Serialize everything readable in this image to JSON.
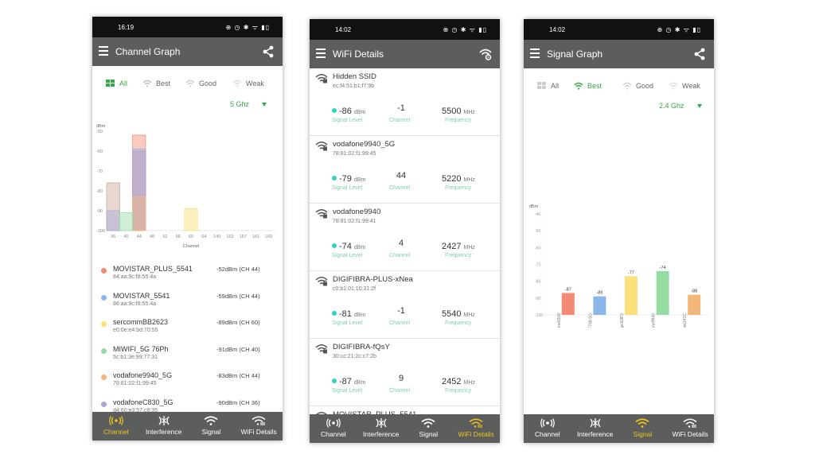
{
  "colors": {
    "app_bar": "#5c5e5e",
    "status_bar": "#111111",
    "accent_green": "#35a849",
    "active_nav": "#f2c417",
    "signal_dot": "#2fd3c0",
    "caption_teal": "#7fd0a9"
  },
  "nav": [
    "Channel",
    "Interference",
    "Signal",
    "WiFi Details"
  ],
  "phone1": {
    "time": "16:19",
    "title": "Channel Graph",
    "filters": [
      "All",
      "Best",
      "Good",
      "Weak"
    ],
    "active_filter": "All",
    "band": "5 Ghz",
    "active_nav": "Channel"
  },
  "phone2": {
    "time": "14:02",
    "title": "WiFi Details",
    "active_nav": "WiFi Details",
    "captions": {
      "level": "Signal Level",
      "channel": "Channel",
      "frequency": "Frequency",
      "dbm": "dBm",
      "mhz": "MHz"
    },
    "aps": [
      {
        "ssid": "Hidden SSID",
        "mac": "ec:f4:51:b1:f7:9b",
        "level": "-86",
        "channel": "-1",
        "frequency": "5500"
      },
      {
        "ssid": "vodafone9940_5G",
        "mac": "78:81:02:f1:99:45",
        "level": "-79",
        "channel": "44",
        "frequency": "5220"
      },
      {
        "ssid": "vodafone9940",
        "mac": "78:81:02:f1:99:41",
        "level": "-74",
        "channel": "4",
        "frequency": "2427"
      },
      {
        "ssid": "DIGIFIBRA-PLUS-xNea",
        "mac": "c0:b1:01:10:31:2f",
        "level": "-81",
        "channel": "-1",
        "frequency": "5540"
      },
      {
        "ssid": "DIGIFIBRA-fQsY",
        "mac": "30:cc:21:2c:c7:2b",
        "level": "-87",
        "channel": "9",
        "frequency": "2452"
      }
    ],
    "partial_ssid": "MOVISTAR_PLUS_5541"
  },
  "phone3": {
    "time": "14:02",
    "title": "Signal Graph",
    "filters": [
      "All",
      "Best",
      "Good",
      "Weak"
    ],
    "active_filter": "Best",
    "band": "2.4 Ghz",
    "active_nav": "Signal"
  },
  "chart_data": [
    {
      "type": "bar",
      "ylabel": "dBm",
      "xlabel": "Channel",
      "ylim": [
        -100,
        -50
      ],
      "yticks": [
        "-50",
        "-60",
        "-70",
        "-80",
        "-90",
        "-100"
      ],
      "categories": [
        "36",
        "40",
        "44",
        "48",
        "52",
        "56",
        "60",
        "64",
        "149",
        "153",
        "157",
        "161",
        "165"
      ],
      "series": [
        {
          "name": "MOVISTAR_PLUS_5541",
          "color": "#f28b74",
          "channels": [
            "44"
          ],
          "value": -52,
          "mac": "84:aa:9c:f8:55:4a",
          "label": "-52dBm (CH 44)"
        },
        {
          "name": "MOVISTAR_5541",
          "color": "#8cb7ea",
          "channels": [
            "44"
          ],
          "value": -59,
          "mac": "86:aa:9c:f8:55:4a",
          "label": "-59dBm (CH 44)"
        },
        {
          "name": "sercommBB2623",
          "color": "#fbe17a",
          "channels": [
            "60"
          ],
          "value": -89,
          "mac": "e0:0e:e4:bd:70:55",
          "label": "-89dBm (CH 60)"
        },
        {
          "name": "MIWIFI_5G 76Ph",
          "color": "#94dca2",
          "channels": [
            "40"
          ],
          "value": -91,
          "mac": "5c:b1:3e:99:77:31",
          "label": "-91dBm (CH 40)"
        },
        {
          "name": "vodafone9940_5G",
          "color": "#f4b77a",
          "channels": [
            "44"
          ],
          "value": -83,
          "mac": "78:81:02:f1:99:45",
          "label": "-83dBm (CH 44)"
        },
        {
          "name": "vodafoneC830_5G",
          "color": "#a9a7da",
          "channels": [
            "36"
          ],
          "value": -90,
          "mac": "d4:60:e3:57:c8:35",
          "label": "-90dBm (CH 36)"
        },
        {
          "name": "",
          "color": "#c9a89a",
          "channels": [
            "36"
          ],
          "value": -76
        },
        {
          "name": "",
          "color": "#b79cc4",
          "channels": [
            "44"
          ],
          "value": -60
        }
      ]
    },
    {
      "type": "bar",
      "ylabel": "dBm",
      "ylim": [
        -100,
        -40
      ],
      "yticks": [
        "-40",
        "-50",
        "-60",
        "-70",
        "-80",
        "-90",
        "-100"
      ],
      "categories": [
        "vodafone9208",
        "MiFibra-F798-5G",
        "Orange-E8F2",
        "vodafone9940",
        "vodafone241C"
      ],
      "values": [
        -87,
        -89,
        -77,
        -74,
        -88
      ],
      "value_labels": [
        "-87",
        "-89",
        "-77",
        "-74",
        "-88"
      ],
      "colors": [
        "#f28b74",
        "#8cb7ea",
        "#fbe17a",
        "#94dca2",
        "#f4b77a"
      ]
    }
  ]
}
